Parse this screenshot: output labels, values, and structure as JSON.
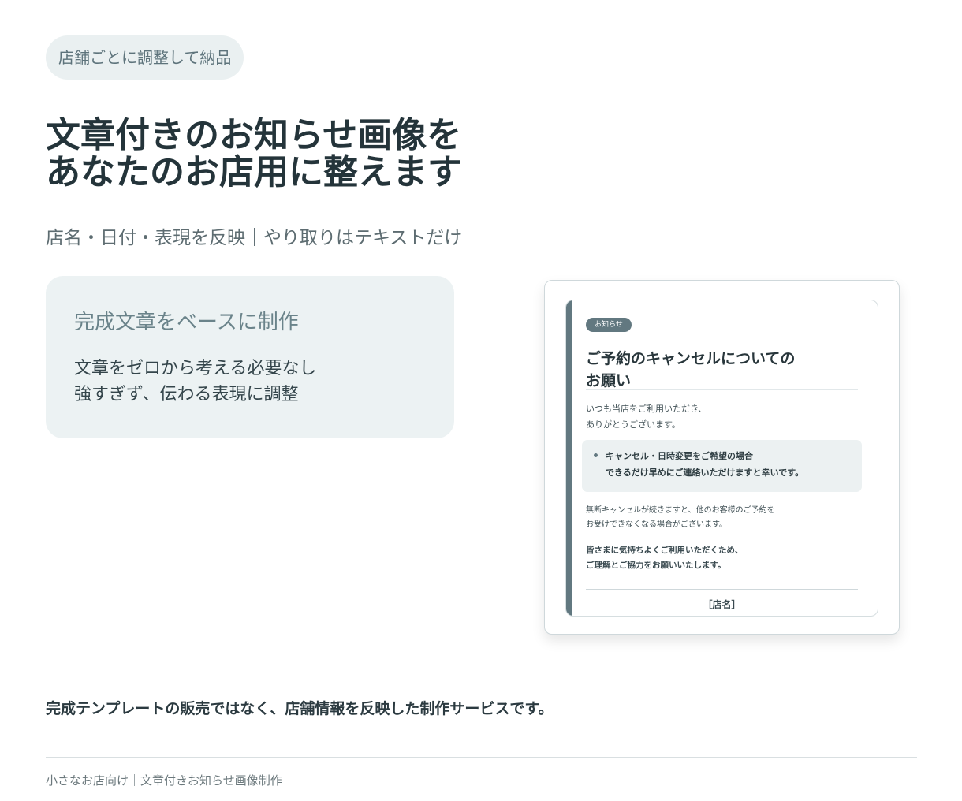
{
  "badge": "店舗ごとに調整して納品",
  "headline": {
    "line1": "文章付きのお知らせ画像を",
    "line2": "あなたのお店用に整えます"
  },
  "subline": "店名・日付・表現を反映｜やり取りはテキストだけ",
  "feature": {
    "title": "完成文章をベースに制作",
    "line1": "文章をゼロから考える必要なし",
    "line2": "強すぎず、伝わる表現に調整"
  },
  "preview": {
    "tag": "お知らせ",
    "title_line1": "ご予約のキャンセルについての",
    "title_line2": "お願い",
    "intro_line1": "いつも当店をご利用いただき、",
    "intro_line2": "ありがとうございます。",
    "box_line1": "キャンセル・日時変更をご希望の場合",
    "box_line2": "できるだけ早めにご連絡いただけますと幸いです。",
    "note_line1": "無断キャンセルが続きますと、他のお客様のご予約を",
    "note_line2": "お受けできなくなる場合がございます。",
    "thanks_line1": "皆さまに気持ちよくご利用いただくため、",
    "thanks_line2": "ご理解とご協力をお願いいたします。",
    "shop": "［店名］"
  },
  "note_line": "完成テンプレートの販売ではなく、店舗情報を反映した制作サービスです。",
  "footer": "小さなお店向け｜文章付きお知らせ画像制作",
  "colors": {
    "accent": "#627880",
    "soft_bg": "#ecf2f3",
    "heading": "#24343a"
  }
}
